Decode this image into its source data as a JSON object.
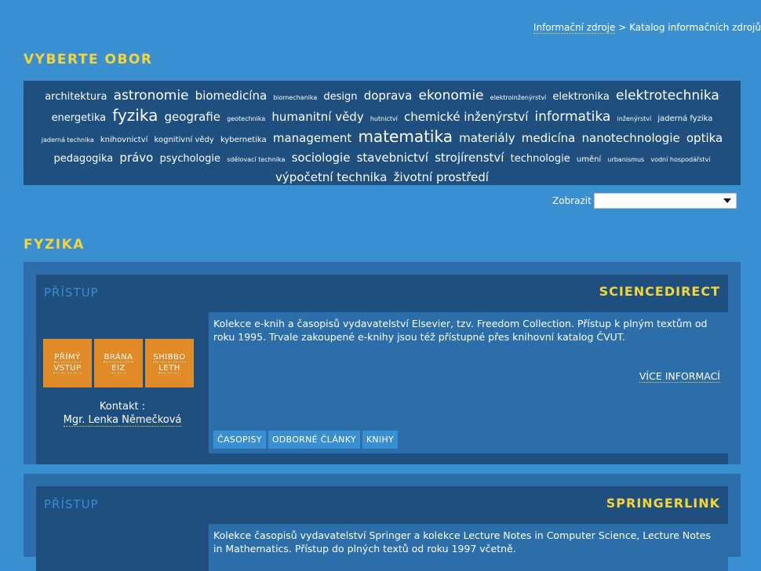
{
  "breadcrumb": {
    "link": "Informační zdroje",
    "separator": ">",
    "current": "Katalog informačních zdrojů"
  },
  "section_obor": {
    "title": "VYBERTE OBOR"
  },
  "tags": [
    {
      "label": "architektura",
      "size": 3
    },
    {
      "label": "astronomie",
      "size": 5
    },
    {
      "label": "biomedicína",
      "size": 4
    },
    {
      "label": "biomechanika",
      "size": 1
    },
    {
      "label": "design",
      "size": 3
    },
    {
      "label": "doprava",
      "size": 4
    },
    {
      "label": "ekonomie",
      "size": 5
    },
    {
      "label": "elektroinženýrství",
      "size": 1
    },
    {
      "label": "elektronika",
      "size": 3
    },
    {
      "label": "elektrotechnika",
      "size": 5
    },
    {
      "label": "energetika",
      "size": 3
    },
    {
      "label": "fyzika",
      "size": 6
    },
    {
      "label": "geografie",
      "size": 4
    },
    {
      "label": "geotechnika",
      "size": 1
    },
    {
      "label": "humanitní vědy",
      "size": 4
    },
    {
      "label": "hutnictví",
      "size": 1
    },
    {
      "label": "chemické inženýrství",
      "size": 4
    },
    {
      "label": "informatika",
      "size": 5
    },
    {
      "label": "inženýrství",
      "size": 1
    },
    {
      "label": "jaderná fyzika",
      "size": 2
    },
    {
      "label": "jaderná technika",
      "size": 1
    },
    {
      "label": "knihovnictví",
      "size": 2
    },
    {
      "label": "kognitivní vědy",
      "size": 2
    },
    {
      "label": "kybernetika",
      "size": 2
    },
    {
      "label": "management",
      "size": 4
    },
    {
      "label": "matematika",
      "size": 6
    },
    {
      "label": "materiály",
      "size": 4
    },
    {
      "label": "medicína",
      "size": 4
    },
    {
      "label": "nanotechnologie",
      "size": 4
    },
    {
      "label": "optika",
      "size": 4
    },
    {
      "label": "pedagogika",
      "size": 3
    },
    {
      "label": "právo",
      "size": 4
    },
    {
      "label": "psychologie",
      "size": 3
    },
    {
      "label": "sdělovací technika",
      "size": 1
    },
    {
      "label": "sociologie",
      "size": 4
    },
    {
      "label": "stavebnictví",
      "size": 4
    },
    {
      "label": "strojírenství",
      "size": 4
    },
    {
      "label": "technologie",
      "size": 3
    },
    {
      "label": "umění",
      "size": 2
    },
    {
      "label": "urbanismus",
      "size": 1
    },
    {
      "label": "vodní hospodářství",
      "size": 1
    },
    {
      "label": "výpočetní technika",
      "size": 4
    },
    {
      "label": "životní prostředí",
      "size": 4
    }
  ],
  "filter": {
    "label": "Zobrazit",
    "selected": ""
  },
  "section_field": {
    "title": "FYZIKA"
  },
  "resources": [
    {
      "access_label": "PŘÍSTUP",
      "title": "SCIENCEDIRECT",
      "buttons": [
        [
          "PŘÍMÝ",
          "VSTUP"
        ],
        [
          "BRÁNA",
          "EIZ"
        ],
        [
          "SHIBBO",
          "LETH"
        ]
      ],
      "contact_label": "Kontakt :",
      "contact_person": "Mgr. Lenka Němečková",
      "description": "Kolekce e-knih a časopisů vydavatelství Elsevier, tzv. Freedom Collection. Přístup k plným textům od roku 1995. Trvale zakoupené e-knihy jsou též přístupné přes knihovní katalog ČVUT.",
      "more_label": "VÍCE INFORMACÍ",
      "tags": [
        "ČASOPISY",
        "ODBORNÉ ČLÁNKY",
        "KNIHY"
      ]
    },
    {
      "access_label": "PŘÍSTUP",
      "title": "SPRINGERLINK",
      "description": "Kolekce časopisů vydavatelství Springer a kolekce Lecture Notes in Computer Science, Lecture Notes in Mathematics. Přístup do plných textů od roku 1997 včetně."
    }
  ]
}
